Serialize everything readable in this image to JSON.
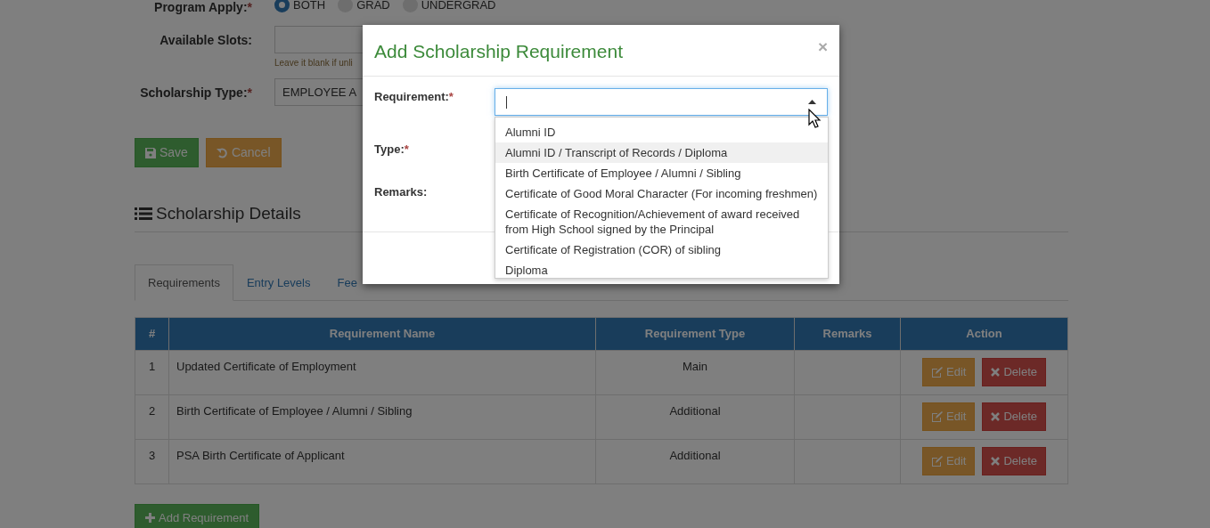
{
  "form": {
    "program_apply": {
      "label": "Program Apply:",
      "required_mark": "*",
      "options": [
        {
          "label": "BOTH",
          "selected": true
        },
        {
          "label": "GRAD",
          "selected": false
        },
        {
          "label": "UNDERGRAD",
          "selected": false
        }
      ]
    },
    "available_slots": {
      "label": "Available Slots:",
      "hint": "Leave it blank if unli"
    },
    "scholarship_type": {
      "label": "Scholarship Type:",
      "required_mark": "*",
      "value": "EMPLOYEE A"
    },
    "buttons": [
      {
        "kind": "save",
        "label": "Save"
      },
      {
        "kind": "cancel",
        "label": "Cancel"
      }
    ]
  },
  "details": {
    "title": "Scholarship Details",
    "tabs": [
      {
        "label": "Requirements",
        "selected": true
      },
      {
        "label": "Entry Levels",
        "selected": false
      },
      {
        "label": "Fee",
        "selected": false
      }
    ],
    "table": {
      "columns": [
        "#",
        "Requirement Name",
        "Requirement Type",
        "Remarks",
        "Action"
      ],
      "rows": [
        {
          "number": "1",
          "name": "Updated Certificate of Employment",
          "type": "Main",
          "actions": [
            "Edit",
            "Delete"
          ]
        },
        {
          "number": "2",
          "name": "Birth Certificate of Employee / Alumni / Sibling",
          "type": "Additional",
          "actions": [
            "Edit",
            "Delete"
          ]
        },
        {
          "number": "3",
          "name": "PSA Birth Certificate of Applicant",
          "type": "Additional",
          "actions": [
            "Edit",
            "Delete"
          ]
        }
      ]
    },
    "add_button": "Add Requirement"
  },
  "modal": {
    "title": "Add Scholarship Requirement",
    "close": "×",
    "fields": [
      {
        "label": "Requirement:",
        "required_mark": "*"
      },
      {
        "label": "Type:",
        "required_mark": "*"
      },
      {
        "label": "Remarks:"
      }
    ],
    "dropdown": {
      "expanded": true,
      "options": [
        {
          "label": "Alumni ID",
          "highlighted": false
        },
        {
          "label": "Alumni ID / Transcript of Records / Diploma",
          "highlighted": true
        },
        {
          "label": "Birth Certificate of Employee / Alumni / Sibling",
          "highlighted": false
        },
        {
          "label": "Certificate of Good Moral Character (For incoming freshmen)",
          "highlighted": false
        },
        {
          "label": "Certificate of Recognition/Achievement of award received from High School signed by the Principal",
          "highlighted": false
        },
        {
          "label": "Certificate of Registration (COR) of sibling",
          "highlighted": false
        },
        {
          "label": "Diploma",
          "highlighted": false
        }
      ]
    }
  }
}
